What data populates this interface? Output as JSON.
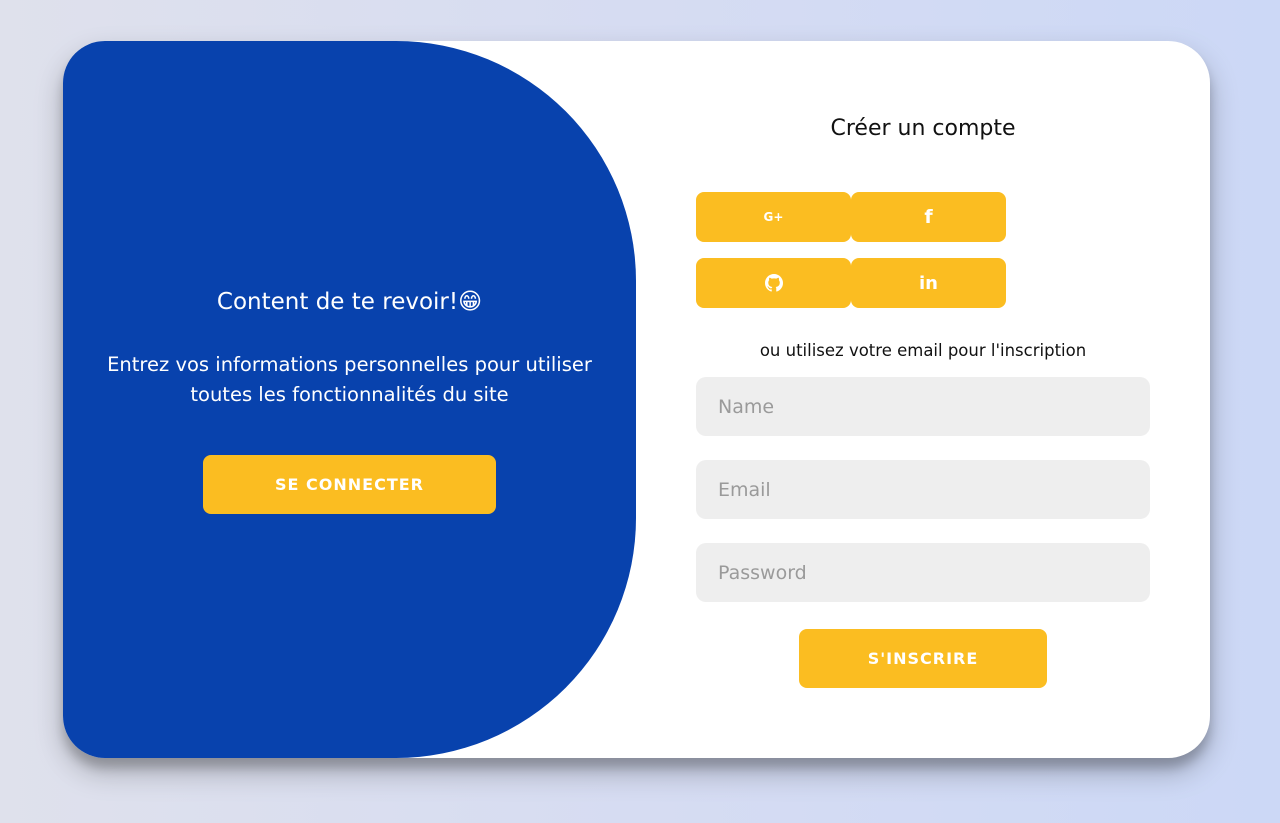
{
  "overlay": {
    "title": "Content de te revoir!😁",
    "text": "Entrez vos informations personnelles pour utiliser toutes les fonctionnalités du site",
    "signin_label": "SE CONNECTER"
  },
  "form": {
    "title": "Créer un compte",
    "social": [
      {
        "icon": "google-plus-icon",
        "glyph": "G+"
      },
      {
        "icon": "facebook-icon",
        "glyph": "f"
      },
      {
        "icon": "github-icon",
        "glyph": ""
      },
      {
        "icon": "linkedin-icon",
        "glyph": "in"
      }
    ],
    "hint": "ou utilisez votre email pour l'inscription",
    "name_placeholder": "Name",
    "email_placeholder": "Email",
    "password_placeholder": "Password",
    "signup_label": "S'INSCRIRE"
  },
  "colors": {
    "primary": "#0842ad",
    "accent": "#fbbd21",
    "input_bg": "#eeeeee"
  }
}
